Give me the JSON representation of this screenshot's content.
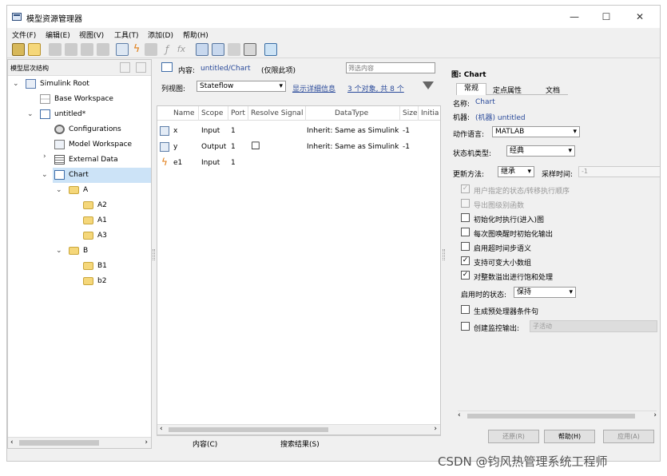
{
  "window": {
    "title": "模型资源管理器",
    "min": "—",
    "max": "☐",
    "close": "✕"
  },
  "menu": [
    "文件(F)",
    "编辑(E)",
    "视图(V)",
    "工具(T)",
    "添加(D)",
    "帮助(H)"
  ],
  "left": {
    "header": "模型层次结构",
    "tree": [
      {
        "label": "Simulink Root",
        "icon": "simulink-root-icon"
      },
      {
        "label": "Base Workspace",
        "icon": "base-workspace-icon"
      },
      {
        "label": "untitled*",
        "icon": "model-icon"
      },
      {
        "label": "Configurations",
        "icon": "gear-icon"
      },
      {
        "label": "Model Workspace",
        "icon": "model-workspace-icon"
      },
      {
        "label": "External Data",
        "icon": "external-data-icon"
      },
      {
        "label": "Chart",
        "icon": "chart-icon"
      },
      {
        "label": "A",
        "icon": "state-icon"
      },
      {
        "label": "A2",
        "icon": "state-icon"
      },
      {
        "label": "A1",
        "icon": "state-icon"
      },
      {
        "label": "A3",
        "icon": "state-icon"
      },
      {
        "label": "B",
        "icon": "state-icon"
      },
      {
        "label": "B1",
        "icon": "state-icon"
      },
      {
        "label": "b2",
        "icon": "state-icon"
      }
    ]
  },
  "middle": {
    "contents_label": "内容:",
    "contents_path": "untitled/Chart",
    "contents_note": "(仅限此项)",
    "filter_placeholder": "筛选内容",
    "view_label": "列视图:",
    "view_value": "Stateflow",
    "show_details": "显示详细信息",
    "count": "3 个对象, 共 8 个",
    "columns": [
      "Name",
      "Scope",
      "Port",
      "Resolve Signal",
      "DataType",
      "Size",
      "Initia"
    ],
    "rows": [
      {
        "name": "x",
        "scope": "Input",
        "port": "1",
        "resolve": "",
        "datatype": "Inherit: Same as Simulink",
        "size": "-1"
      },
      {
        "name": "y",
        "scope": "Output",
        "port": "1",
        "resolve": "☐",
        "datatype": "Inherit: Same as Simulink",
        "size": "-1"
      },
      {
        "name": "e1",
        "scope": "Input",
        "port": "1",
        "resolve": "",
        "datatype": "",
        "size": ""
      }
    ],
    "tabs": [
      "内容(C)",
      "搜索结果(S)"
    ]
  },
  "right": {
    "header": "图: Chart",
    "tabs": [
      "常规",
      "定点属性",
      "文档"
    ],
    "name_label": "名称:",
    "name_value": "Chart",
    "machine_label": "机器:",
    "machine_value": "(机器) untitled",
    "action_lang_label": "动作语言:",
    "action_lang_value": "MATLAB",
    "sm_type_label": "状态机类型:",
    "sm_type_value": "经典",
    "update_label": "更新方法:",
    "update_value": "继承",
    "sample_label": "采样时间:",
    "sample_value": "-1",
    "checks": [
      {
        "label": "用户指定的状态/转移执行顺序",
        "checked": true,
        "disabled": true
      },
      {
        "label": "导出图级别函数",
        "checked": false,
        "disabled": true
      },
      {
        "label": "初始化时执行(进入)图",
        "checked": false,
        "disabled": false
      },
      {
        "label": "每次图唤醒时初始化输出",
        "checked": false,
        "disabled": false
      },
      {
        "label": "启用超时间步语义",
        "checked": false,
        "disabled": false
      },
      {
        "label": "支持可变大小数组",
        "checked": true,
        "disabled": false
      },
      {
        "label": "对整数溢出进行饱和处理",
        "checked": true,
        "disabled": false
      }
    ],
    "startup_label": "启用时的状态:",
    "startup_value": "保持",
    "gen_preproc": "生成预处理器条件句",
    "monitor_label": "创建监控输出:",
    "monitor_value": "子活动",
    "buttons": [
      "还原(R)",
      "帮助(H)",
      "应用(A)"
    ]
  },
  "watermark": "CSDN @钧风热管理系统工程师"
}
